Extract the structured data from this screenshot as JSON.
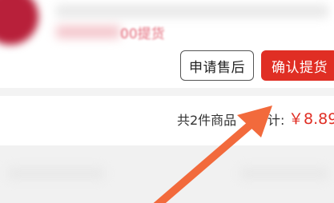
{
  "header": {
    "blurred_text": "00提货"
  },
  "actions": {
    "after_sale_label": "申请售后",
    "confirm_pickup_label": "确认提货"
  },
  "summary": {
    "item_count_text": "共2件商品",
    "total_label": "计:",
    "total_value": "￥8.89"
  },
  "colors": {
    "accent_red": "#e02e24",
    "annotation_arrow": "#f26a3c"
  },
  "annotation": {
    "icon": "arrow-annotation-icon"
  }
}
